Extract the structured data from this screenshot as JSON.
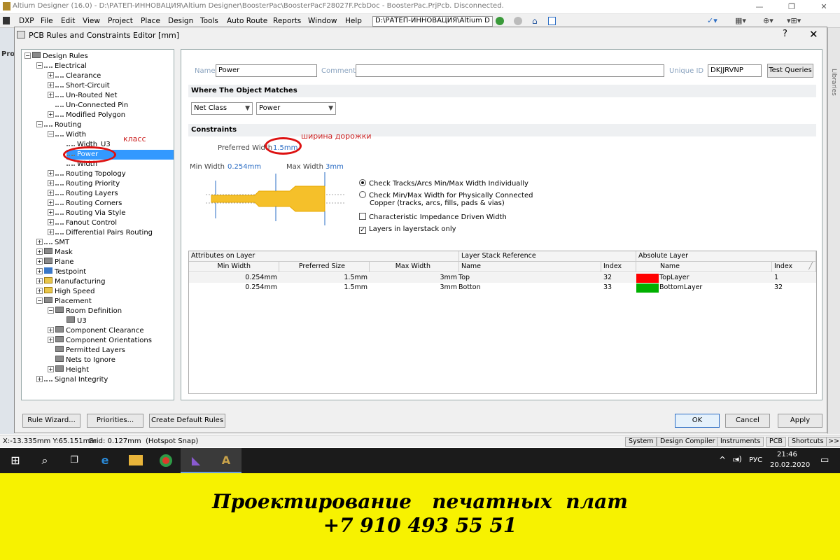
{
  "app": {
    "title": "Altium Designer (16.0) - D:\\РАТЕП-ИННОВАЦИЯ\\Altium Designer\\BoosterPac\\BoosterPacF28027F.PcbDoc - BoosterPac.PrjPcb. Disconnected."
  },
  "menu": {
    "items": [
      "DXP",
      "File",
      "Edit",
      "View",
      "Project",
      "Place",
      "Design",
      "Tools",
      "Auto Route",
      "Reports",
      "Window",
      "Help"
    ],
    "path": "D:\\РАТЕП-ИННОВАЦИЯ\\Altium D"
  },
  "left_strip": {
    "label": "Pro"
  },
  "right_strip": {
    "label": "Libraries"
  },
  "dialog": {
    "title": "PCB Rules and Constraints Editor [mm]",
    "help": "?",
    "close": "✕"
  },
  "tree": [
    {
      "label": "Design Rules"
    },
    {
      "label": "Electrical"
    },
    {
      "label": "Clearance"
    },
    {
      "label": "Short-Circuit"
    },
    {
      "label": "Un-Routed Net"
    },
    {
      "label": "Un-Connected Pin"
    },
    {
      "label": "Modified Polygon"
    },
    {
      "label": "Routing"
    },
    {
      "label": "Width"
    },
    {
      "label": "Width_U3"
    },
    {
      "label": "Power"
    },
    {
      "label": "Width"
    },
    {
      "label": "Routing Topology"
    },
    {
      "label": "Routing Priority"
    },
    {
      "label": "Routing Layers"
    },
    {
      "label": "Routing Corners"
    },
    {
      "label": "Routing Via Style"
    },
    {
      "label": "Fanout Control"
    },
    {
      "label": "Differential Pairs Routing"
    },
    {
      "label": "SMT"
    },
    {
      "label": "Mask"
    },
    {
      "label": "Plane"
    },
    {
      "label": "Testpoint"
    },
    {
      "label": "Manufacturing"
    },
    {
      "label": "High Speed"
    },
    {
      "label": "Placement"
    },
    {
      "label": "Room Definition"
    },
    {
      "label": "U3"
    },
    {
      "label": "Component Clearance"
    },
    {
      "label": "Component Orientations"
    },
    {
      "label": "Permitted Layers"
    },
    {
      "label": "Nets to Ignore"
    },
    {
      "label": "Height"
    },
    {
      "label": "Signal Integrity"
    }
  ],
  "annotations": {
    "class_label": "класс",
    "width_label": "ширина дорожки"
  },
  "rule": {
    "name_label": "Name",
    "name_value": "Power",
    "comment_label": "Comment",
    "comment_value": "",
    "uid_label": "Unique ID",
    "uid_value": "DKJJRVNP",
    "test_queries": "Test Queries"
  },
  "match": {
    "section_title": "Where The Object Matches",
    "combo1": "Net Class",
    "combo2": "Power"
  },
  "constraints": {
    "section_title": "Constraints",
    "preferred_label": "Preferred Width",
    "preferred_value": "1.5mm",
    "min_label": "Min Width",
    "min_value": "0.254mm",
    "max_label": "Max Width",
    "max_value": "3mm",
    "opt1": "Check Tracks/Arcs Min/Max Width Individually",
    "opt2_line1": "Check Min/Max Width for Physically Connected",
    "opt2_line2": "Copper (tracks, arcs, fills, pads & vias)",
    "chk1": "Characteristic Impedance Driven Width",
    "chk2": "Layers in layerstack only"
  },
  "grid": {
    "group_headers": [
      "Attributes on Layer",
      "Layer Stack Reference",
      "Absolute Layer"
    ],
    "columns": [
      "Min Width",
      "Preferred Size",
      "Max Width",
      "Name",
      "Index",
      "Name",
      "Index"
    ],
    "rows": [
      {
        "min": "0.254mm",
        "pref": "1.5mm",
        "max": "3mm",
        "name": "Top",
        "index": "32",
        "color": "#ff0000",
        "abs_name": "TopLayer",
        "abs_index": "1"
      },
      {
        "min": "0.254mm",
        "pref": "1.5mm",
        "max": "3mm",
        "name": "Botton",
        "index": "33",
        "color": "#00b000",
        "abs_name": "BottomLayer",
        "abs_index": "32"
      }
    ]
  },
  "buttons": {
    "rule_wizard": "Rule Wizard...",
    "priorities": "Priorities...",
    "create_default": "Create Default Rules",
    "ok": "OK",
    "cancel": "Cancel",
    "apply": "Apply"
  },
  "status": {
    "coords": "X:-13.335mm Y:65.151mm",
    "grid": "Grid: 0.127mm",
    "snap": "(Hotspot Snap)",
    "panels": [
      "System",
      "Design Compiler",
      "Instruments",
      "PCB",
      "Shortcuts"
    ],
    "more": ">>"
  },
  "taskbar": {
    "lang": "РУС",
    "time": "21:46",
    "date": "20.02.2020"
  },
  "banner": {
    "line1": "Проектирование   печатных  плат",
    "line2": "+7 910 493 55 51"
  }
}
